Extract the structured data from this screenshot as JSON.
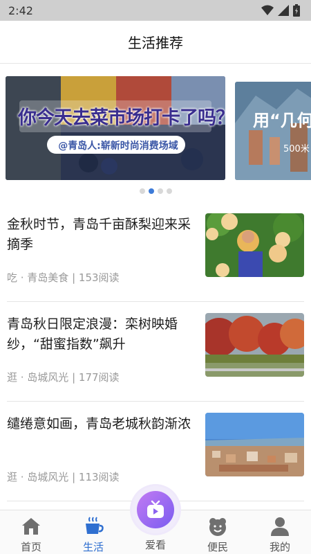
{
  "status_bar": {
    "time": "2:42"
  },
  "header": {
    "title": "生活推荐"
  },
  "banner": {
    "slides": [
      {
        "headline": "你今天去菜市场打卡了吗？",
        "tag": "@青岛人:崭新时尚消费场域"
      },
      {
        "headline": "用“几何",
        "tag": "500米"
      }
    ]
  },
  "news": [
    {
      "title": "金秋时节，青岛千亩酥梨迎来采摘季",
      "meta": "吃 · 青岛美食 | 153阅读",
      "thumb": "pear-harvest-photo"
    },
    {
      "title": "青岛秋日限定浪漫：栾树映婚纱，“甜蜜指数”飙升",
      "meta": "逛 · 岛城风光 | 177阅读",
      "thumb": "autumn-trees-photo"
    },
    {
      "title": "缱绻意如画，青岛老城秋韵渐浓",
      "meta": "逛 · 岛城风光 | 113阅读",
      "thumb": "old-town-photo"
    }
  ],
  "tabbar": {
    "home": "首页",
    "life": "生活",
    "watch": "爱看",
    "service": "便民",
    "mine": "我的"
  },
  "colors": {
    "accent": "#2f6fd0",
    "center_button": "#8b62f0"
  }
}
